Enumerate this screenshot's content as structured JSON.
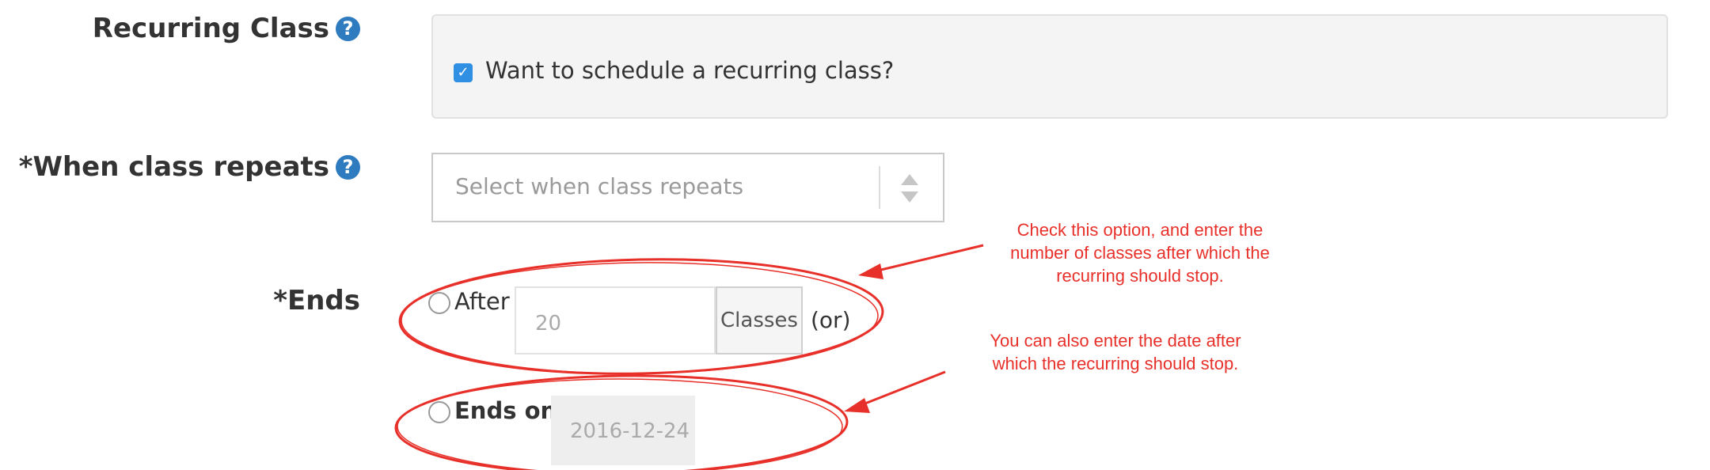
{
  "recurring": {
    "label": "Recurring Class",
    "help_glyph": "?",
    "checkbox_checked": true,
    "checkbox_label": "Want to schedule a recurring class?"
  },
  "repeats": {
    "label": "*When class repeats",
    "help_glyph": "?",
    "placeholder": "Select when class repeats"
  },
  "ends": {
    "label": "*Ends",
    "after_label": "After",
    "after_value": "20",
    "after_addon": "Classes",
    "or_text": "(or)",
    "ends_on_label": "Ends on",
    "ends_on_value": "2016-12-24"
  },
  "annotations": {
    "after_note": "Check this option, and enter the\nnumber of classes after which the\nrecurring should stop.",
    "ends_on_note": "You can also enter the date after\nwhich the recurring should stop."
  },
  "colors": {
    "accent_blue": "#2f8fe3",
    "help_icon": "#2f7bbf",
    "annotation_red": "#e8302a"
  }
}
